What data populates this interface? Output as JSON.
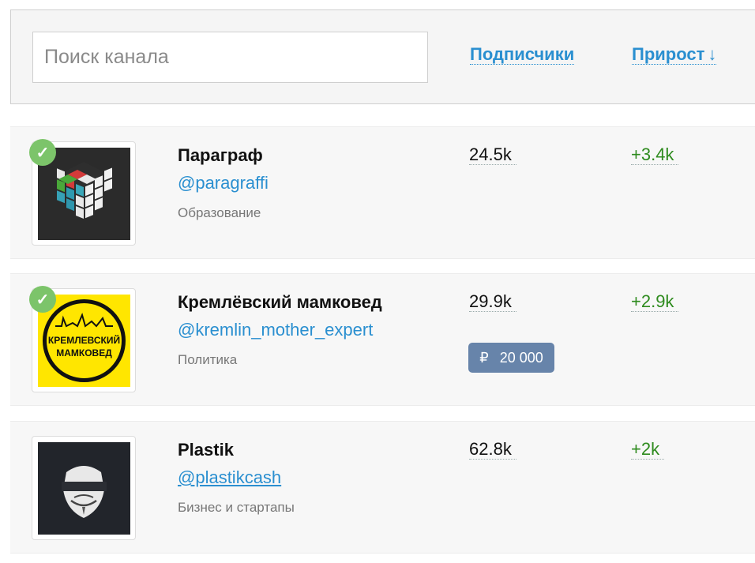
{
  "search": {
    "placeholder": "Поиск канала"
  },
  "header": {
    "subscribers_label": "Подписчики",
    "growth_label": "Прирост",
    "growth_arrow": "↓"
  },
  "channels": [
    {
      "name": "Параграф",
      "handle": "@paragraffi",
      "category": "Образование",
      "subscribers": "24.5k",
      "growth": "+3.4k",
      "verified": true,
      "avatar": "rubiks-cube-icon"
    },
    {
      "name": "Кремлёвский мамковед",
      "handle": "@kremlin_mother_expert",
      "category": "Политика",
      "subscribers": "29.9k",
      "growth": "+2.9k",
      "verified": true,
      "avatar": "kremlin-logo",
      "avatar_text": "КРЕМЛЕВСКИЙ МАМКОВЕД",
      "price": {
        "currency": "₽",
        "amount": "20 000"
      }
    },
    {
      "name": "Plastik",
      "handle": "@plastikcash",
      "category": "Бизнес и стартапы",
      "subscribers": "62.8k",
      "growth": "+2k",
      "verified": false,
      "avatar": "guy-fawkes-mask-icon"
    }
  ],
  "colors": {
    "link": "#2a8fd0",
    "growth": "#2e8b1e",
    "verified": "#7cc46a",
    "badge": "#6784aa"
  }
}
